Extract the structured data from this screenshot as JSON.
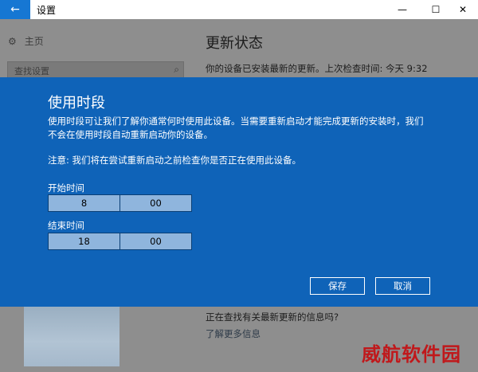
{
  "titlebar": {
    "back_icon": "←",
    "title": "设置",
    "minimize": "—",
    "maximize": "☐",
    "close": "✕"
  },
  "nav": {
    "home_label": "主页",
    "home_icon": "⚙",
    "search_placeholder": "查找设置",
    "search_icon": "⌕"
  },
  "main": {
    "title": "更新状态",
    "status": "你的设备已安装最新的更新。上次检查时间: 今天 9:32",
    "info_question": "正在查找有关最新更新的信息吗?",
    "learn_more": "了解更多信息"
  },
  "dialog": {
    "title": "使用时段",
    "description": "使用时段可让我们了解你通常何时使用此设备。当需要重新启动才能完成更新的安装时，我们不会在使用时段自动重新启动你的设备。",
    "note": "注意: 我们将在尝试重新启动之前检查你是否正在使用此设备。",
    "start_label": "开始时间",
    "start_hour": "8",
    "start_minute": "00",
    "end_label": "结束时间",
    "end_hour": "18",
    "end_minute": "00",
    "save_label": "保存",
    "cancel_label": "取消",
    "background_color": "#0f63b8"
  },
  "watermark": "威航软件园"
}
